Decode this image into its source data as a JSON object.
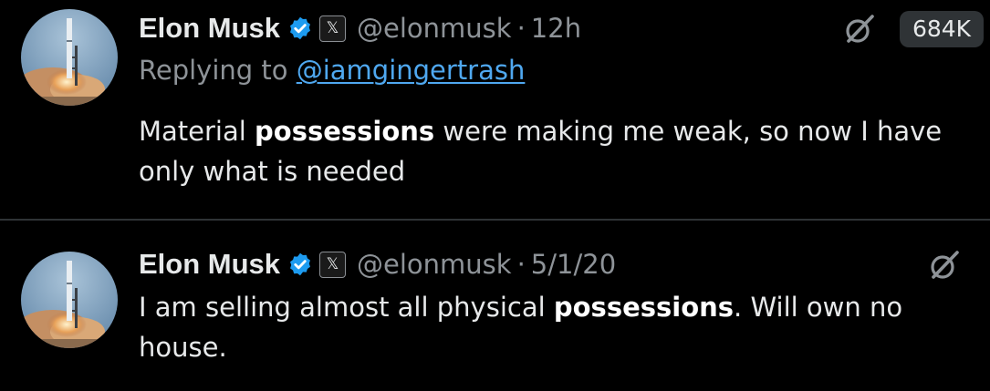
{
  "colors": {
    "background": "#000000",
    "text": "#e7e9ea",
    "muted": "#8e9398",
    "link": "#4fa8f0",
    "verified": "#1d9bf0",
    "divider": "#2f3336"
  },
  "tweets": [
    {
      "author": {
        "name": "Elon Musk",
        "handle": "@elonmusk",
        "verified_icon": "verified-badge-icon",
        "affiliate_badge": "𝕏"
      },
      "separator": "·",
      "time": "12h",
      "grok_icon": "grok-icon",
      "views": "684K",
      "reply_prefix": "Replying to ",
      "reply_handle": "@iamgingertrash",
      "text_before": "Material ",
      "text_bold": "possessions",
      "text_after": " were making me weak, so now I have only what is needed"
    },
    {
      "author": {
        "name": "Elon Musk",
        "handle": "@elonmusk",
        "verified_icon": "verified-badge-icon",
        "affiliate_badge": "𝕏"
      },
      "separator": "·",
      "time": "5/1/20",
      "grok_icon": "grok-icon",
      "text_before": "I am selling almost all physical ",
      "text_bold": "possessions",
      "text_after": ". Will own no house."
    }
  ]
}
